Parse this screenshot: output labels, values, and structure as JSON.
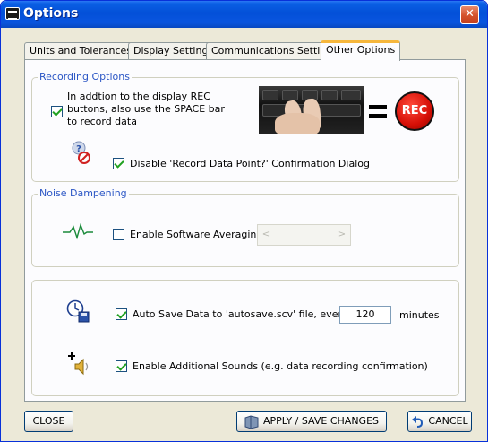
{
  "window": {
    "title": "Options",
    "close_glyph": "✕"
  },
  "tabs": [
    {
      "label": "Units and Tolerances",
      "active": false
    },
    {
      "label": "Display Settings",
      "active": false
    },
    {
      "label": "Communications Settings",
      "active": false
    },
    {
      "label": "Other Options",
      "active": true
    }
  ],
  "recording": {
    "legend": "Recording Options",
    "space_bar_checked": true,
    "space_bar_label": [
      "In addtion to the display REC",
      "buttons, also use the SPACE bar",
      "to record data"
    ],
    "rec_label": "REC",
    "disable_confirm_checked": true,
    "disable_confirm_label": "Disable 'Record Data Point?' Confirmation Dialog"
  },
  "noise": {
    "legend": "Noise Dampening",
    "averaging_checked": false,
    "averaging_label": "Enable Software Averaging",
    "combo_left": "<",
    "combo_right": ">"
  },
  "misc": {
    "autosave_checked": true,
    "autosave_label": "Auto Save Data to 'autosave.scv' file, every :",
    "autosave_minutes": "120",
    "minutes_label": "minutes",
    "sounds_checked": true,
    "sounds_label": "Enable Additional Sounds (e.g. data recording confirmation)"
  },
  "footer": {
    "close_label": "CLOSE",
    "apply_label": "APPLY / SAVE CHANGES",
    "cancel_label": "CANCEL"
  },
  "icons": {
    "app": "app-icon",
    "help_prohibited": "help-prohibited-icon",
    "waveform": "waveform-icon",
    "clock_save": "clock-save-icon",
    "sound_add": "sound-add-icon",
    "apply": "apply-icon",
    "undo": "undo-icon"
  },
  "colors": {
    "title_bar": "#0350d8",
    "legend_text": "#2b56c5",
    "active_tab_accent": "#f6b73c",
    "check": "#21a121",
    "rec_red": "#d50f06"
  }
}
